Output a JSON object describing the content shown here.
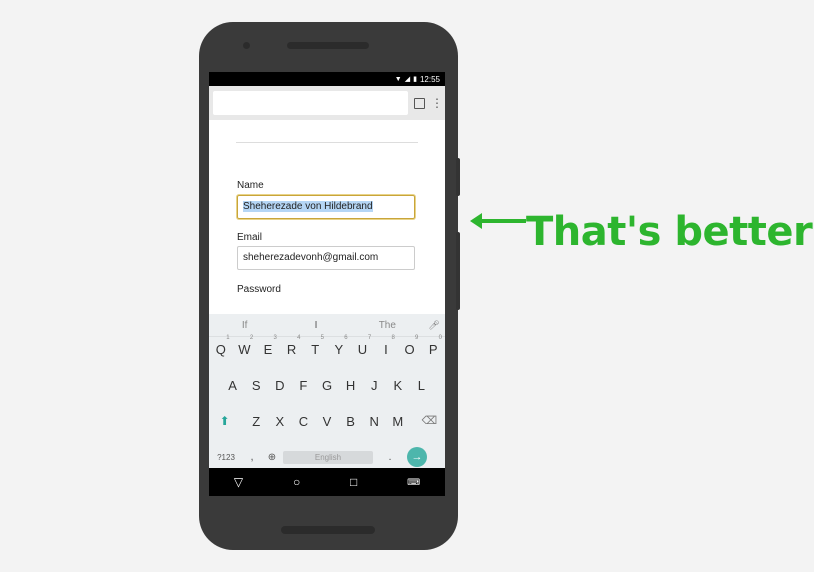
{
  "status": {
    "time": "12:55",
    "icons": [
      "wifi-icon",
      "signal-icon",
      "battery-icon"
    ]
  },
  "browser": {
    "url_value": "",
    "tabs_icon": "tabs-icon",
    "menu_icon": "overflow-menu-icon"
  },
  "form": {
    "name_label": "Name",
    "name_value": "Sheherezade von Hildebrand",
    "email_label": "Email",
    "email_value": "sheherezadevonh@gmail.com",
    "password_label": "Password"
  },
  "keyboard": {
    "suggestions": [
      "If",
      "I",
      "The"
    ],
    "row1": [
      {
        "k": "Q",
        "n": "1"
      },
      {
        "k": "W",
        "n": "2"
      },
      {
        "k": "E",
        "n": "3"
      },
      {
        "k": "R",
        "n": "4"
      },
      {
        "k": "T",
        "n": "5"
      },
      {
        "k": "Y",
        "n": "6"
      },
      {
        "k": "U",
        "n": "7"
      },
      {
        "k": "I",
        "n": "8"
      },
      {
        "k": "O",
        "n": "9"
      },
      {
        "k": "P",
        "n": "0"
      }
    ],
    "row2": [
      "A",
      "S",
      "D",
      "F",
      "G",
      "H",
      "J",
      "K",
      "L"
    ],
    "row3": [
      "Z",
      "X",
      "C",
      "V",
      "B",
      "N",
      "M"
    ],
    "symbols": "?123",
    "comma": ",",
    "space": "English",
    "period": "."
  },
  "callout": {
    "text": "That's better!",
    "color": "#2db52e"
  }
}
